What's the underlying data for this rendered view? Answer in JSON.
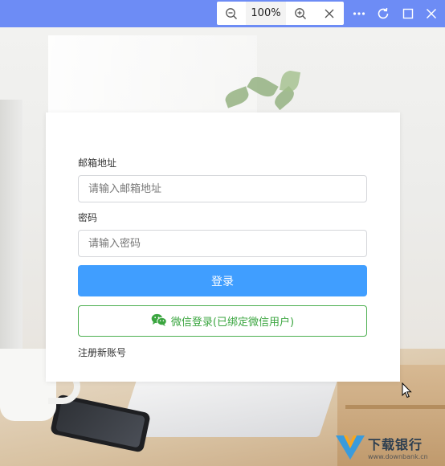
{
  "toolbar": {
    "zoom_out_icon": "zoom-out-icon",
    "zoom_level": "100%",
    "zoom_in_icon": "zoom-in-icon",
    "close_zoom_icon": "close-icon",
    "more_icon": "more-icon",
    "refresh_icon": "refresh-icon",
    "maximize_icon": "maximize-icon",
    "close_window_icon": "close-icon",
    "bar_color": "#6d8cf5"
  },
  "login": {
    "email_label": "邮箱地址",
    "email_placeholder": "请输入邮箱地址",
    "email_value": "",
    "password_label": "密码",
    "password_placeholder": "请输入密码",
    "password_value": "",
    "login_button": "登录",
    "wechat_button": "微信登录(已绑定微信用户)",
    "wechat_icon": "wechat-icon",
    "register_link": "注册新账号",
    "primary_color": "#409eff",
    "wechat_color": "#3aa53f"
  },
  "watermark": {
    "name": "下载银行",
    "url": "www.downbank.cn"
  }
}
